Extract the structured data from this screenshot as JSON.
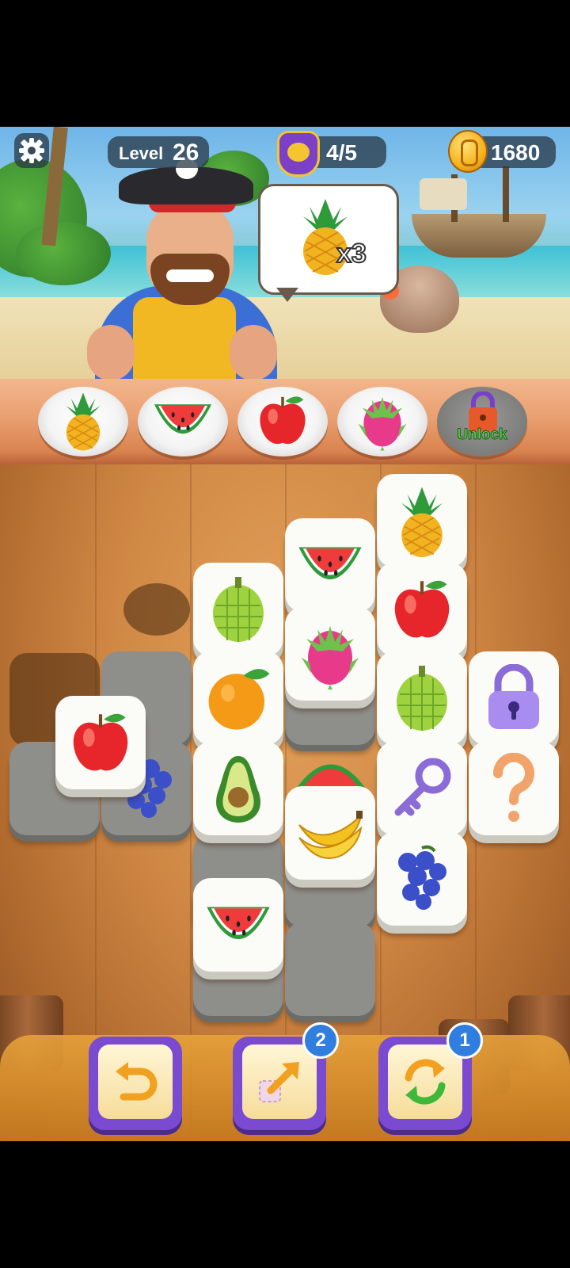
{
  "hud": {
    "level_label": "Level",
    "level_number": "26",
    "progress": "4/5",
    "coins": "1680"
  },
  "order": {
    "fruit": "pineapple",
    "quantity": "x3"
  },
  "slots": [
    {
      "fruit": "pineapple"
    },
    {
      "fruit": "watermelon"
    },
    {
      "fruit": "apple"
    },
    {
      "fruit": "dragonfruit"
    },
    {
      "locked": true,
      "label": "Unlock"
    }
  ],
  "board": {
    "tiles": [
      "pineapple",
      "watermelon",
      "apple",
      "durian",
      "dragonfruit",
      "orange",
      "durian",
      "lock",
      "apple",
      "grape",
      "avocado",
      "watermelon",
      "key",
      "question",
      "banana",
      "grape",
      "watermelon"
    ]
  },
  "boosters": [
    {
      "name": "undo",
      "count": null
    },
    {
      "name": "move-out",
      "count": "2"
    },
    {
      "name": "shuffle",
      "count": "1"
    }
  ],
  "colors": {
    "accent": "#7a4ad1",
    "badge": "#2f7ee0",
    "coin": "#f6b21b"
  }
}
